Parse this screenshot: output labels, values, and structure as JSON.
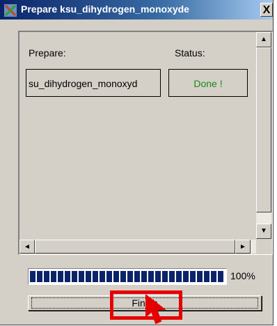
{
  "window": {
    "title": "Prepare ksu_dihydrogen_monoxyde",
    "close_label": "X"
  },
  "table": {
    "prepare_header": "Prepare:",
    "status_header": "Status:",
    "rows": [
      {
        "name": "su_dihydrogen_monoxyd",
        "status": "Done !",
        "status_color": "#1a8a1a"
      }
    ]
  },
  "scrollbars": {
    "up": "▲",
    "down": "▼",
    "left": "◄",
    "right": "►"
  },
  "progress": {
    "value": 1.0,
    "label": "100%",
    "fill_color": "#0a246a"
  },
  "buttons": {
    "finish_label": "Finish"
  },
  "annotation": {
    "highlight_color": "#e60000"
  }
}
